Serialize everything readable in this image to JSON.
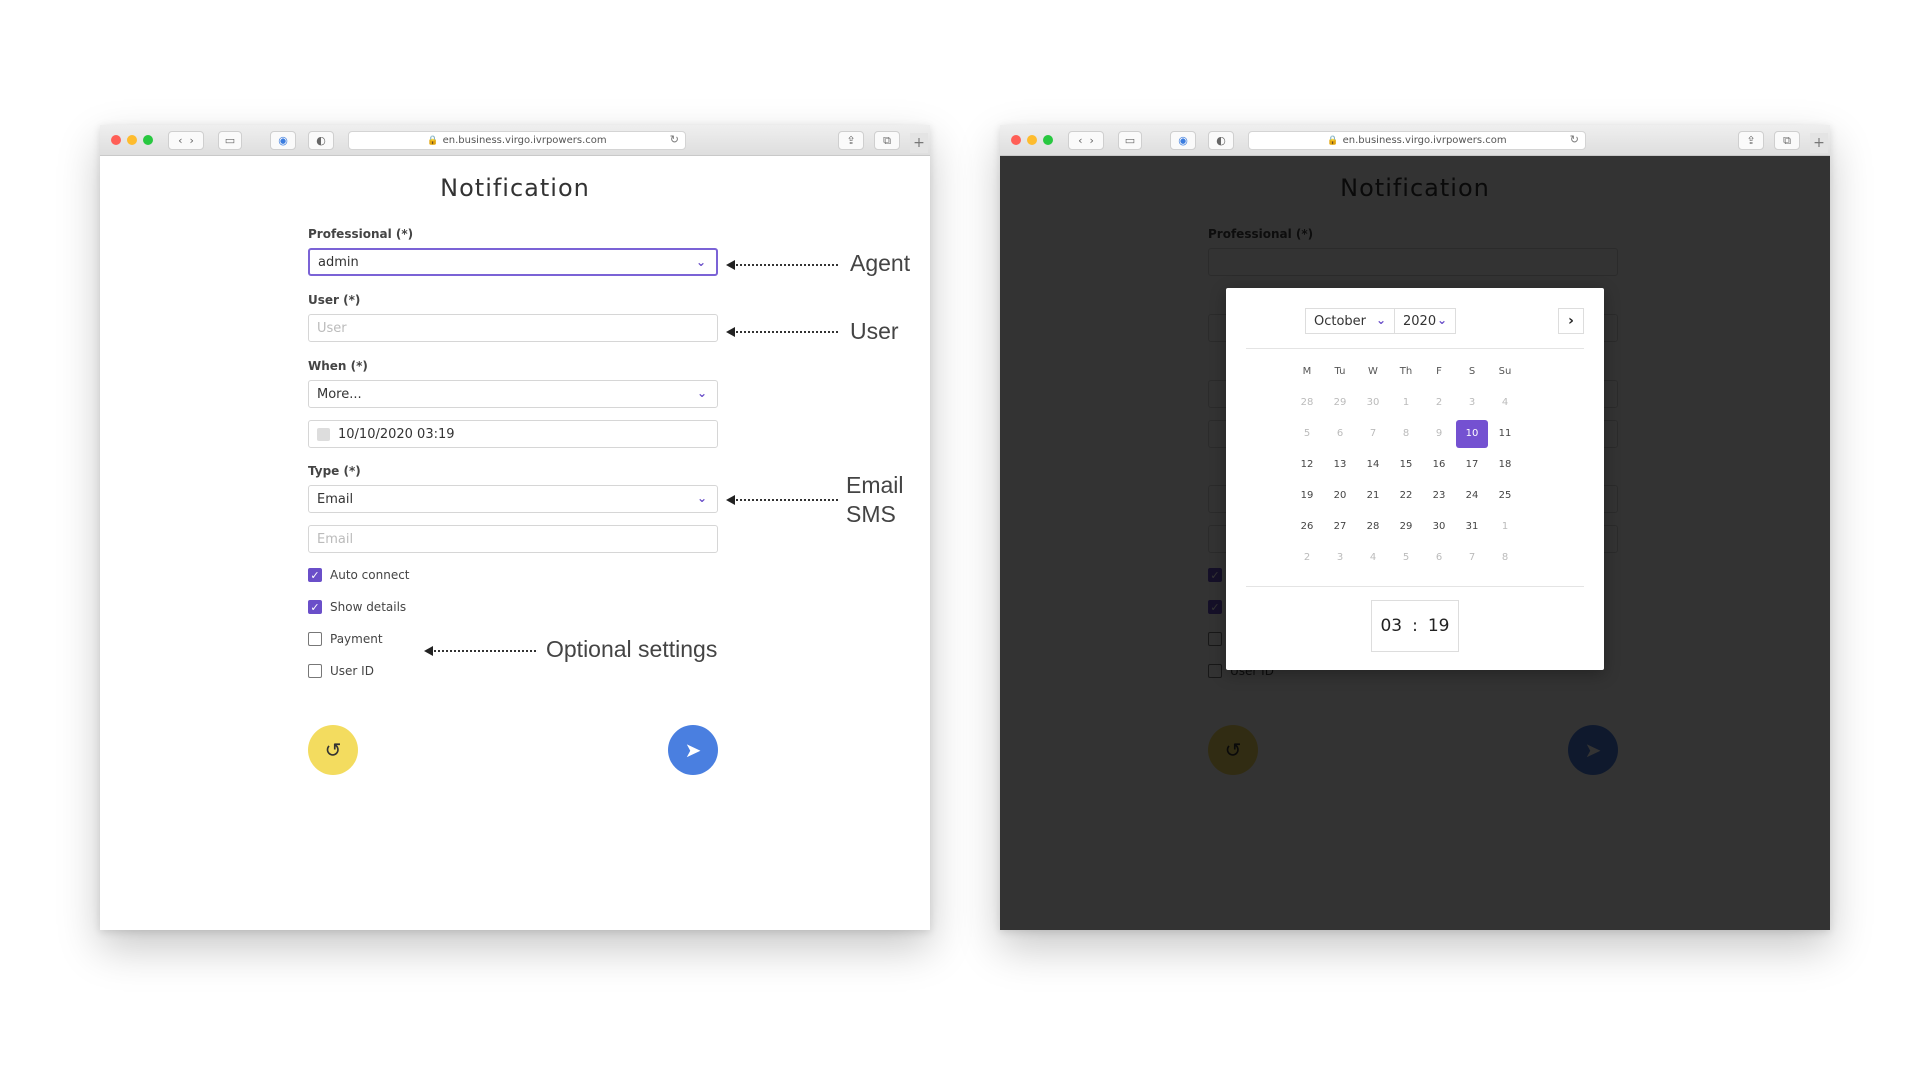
{
  "browser": {
    "url": "en.business.virgo.ivrpowers.com"
  },
  "form": {
    "title": "Notification",
    "professional_label": "Professional (*)",
    "professional_value": "admin",
    "user_label": "User (*)",
    "user_placeholder": "User",
    "when_label": "When (*)",
    "when_value": "More...",
    "datetime_value": "10/10/2020 03:19",
    "type_label": "Type (*)",
    "type_value": "Email",
    "email_placeholder": "Email",
    "checkboxes": [
      {
        "label": "Auto connect",
        "checked": true
      },
      {
        "label": "Show details",
        "checked": true
      },
      {
        "label": "Payment",
        "checked": false
      },
      {
        "label": "User ID",
        "checked": false
      }
    ],
    "reset_icon": "reset-icon",
    "send_icon": "send-icon"
  },
  "annotations": {
    "agent": "Agent",
    "user": "User",
    "email": "Email",
    "sms": "SMS",
    "optional": "Optional settings"
  },
  "datepicker": {
    "month": "October",
    "year": "2020",
    "weekdays": [
      "M",
      "Tu",
      "W",
      "Th",
      "F",
      "S",
      "Su"
    ],
    "weeks": [
      [
        "28",
        "29",
        "30",
        "1",
        "2",
        "3",
        "4"
      ],
      [
        "5",
        "6",
        "7",
        "8",
        "9",
        "10",
        "11"
      ],
      [
        "12",
        "13",
        "14",
        "15",
        "16",
        "17",
        "18"
      ],
      [
        "19",
        "20",
        "21",
        "22",
        "23",
        "24",
        "25"
      ],
      [
        "26",
        "27",
        "28",
        "29",
        "30",
        "31",
        "1"
      ],
      [
        "2",
        "3",
        "4",
        "5",
        "6",
        "7",
        "8"
      ]
    ],
    "muted": [
      [
        true,
        true,
        true,
        true,
        true,
        true,
        true
      ],
      [
        true,
        true,
        true,
        true,
        true,
        false,
        false
      ],
      [
        false,
        false,
        false,
        false,
        false,
        false,
        false
      ],
      [
        false,
        false,
        false,
        false,
        false,
        false,
        false
      ],
      [
        false,
        false,
        false,
        false,
        false,
        false,
        true
      ],
      [
        true,
        true,
        true,
        true,
        true,
        true,
        true
      ]
    ],
    "selected": "10",
    "hour": "03",
    "minute": "19"
  },
  "colors": {
    "accent": "#6a4fc9",
    "send": "#4a7fe0",
    "reset": "#f3dc5f"
  }
}
